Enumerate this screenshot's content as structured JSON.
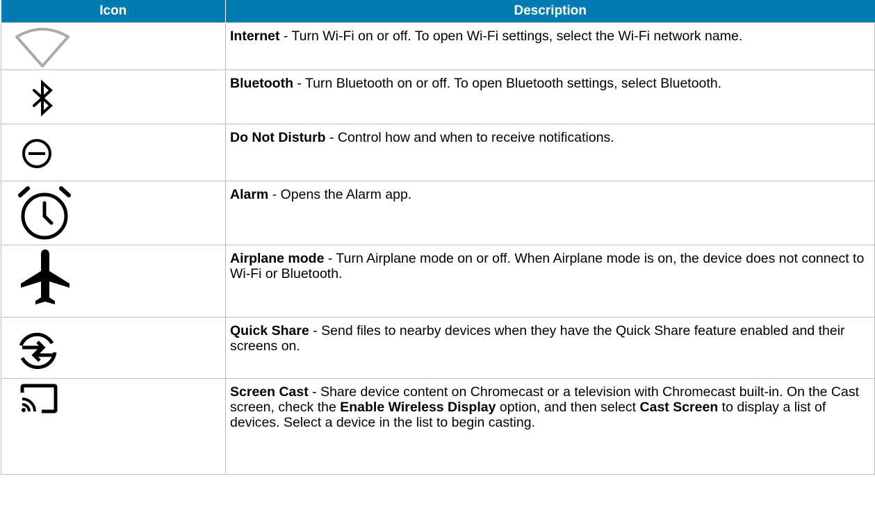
{
  "header": {
    "icon_col": "Icon",
    "desc_col": "Description"
  },
  "rows": [
    {
      "icon": "wifi-icon",
      "title": "Internet",
      "text": " - Turn Wi-Fi on or off. To open Wi-Fi settings, select the Wi-Fi network name."
    },
    {
      "icon": "bluetooth-icon",
      "title": "Bluetooth",
      "text": " - Turn Bluetooth on or off. To open Bluetooth settings, select Bluetooth."
    },
    {
      "icon": "do-not-disturb-icon",
      "title": "Do Not Disturb",
      "text": " - Control how and when to receive notifications."
    },
    {
      "icon": "alarm-icon",
      "title": "Alarm",
      "text": " - Opens the Alarm app."
    },
    {
      "icon": "airplane-icon",
      "title": "Airplane mode",
      "text": " - Turn Airplane mode on or off. When Airplane mode is on, the device does not connect to Wi-Fi or Bluetooth."
    },
    {
      "icon": "quick-share-icon",
      "title": "Quick Share",
      "text": " - Send files to nearby devices when they have the Quick Share feature enabled and their screens on."
    },
    {
      "icon": "screen-cast-icon",
      "title": "Screen Cast",
      "text_a": " - Share device content on Chromecast or a television with Chromecast built-in. On the Cast screen, check the ",
      "bold_a": "Enable Wireless Display",
      "text_b": " option, and then select ",
      "bold_b": "Cast Screen",
      "text_c": " to display a list of devices. Select a device in the list to begin casting."
    }
  ],
  "colors": {
    "header_bg": "#007cb0",
    "header_text": "#ffffff",
    "border": "#bdbdbd",
    "wifi_outline": "#aaaaaa"
  }
}
